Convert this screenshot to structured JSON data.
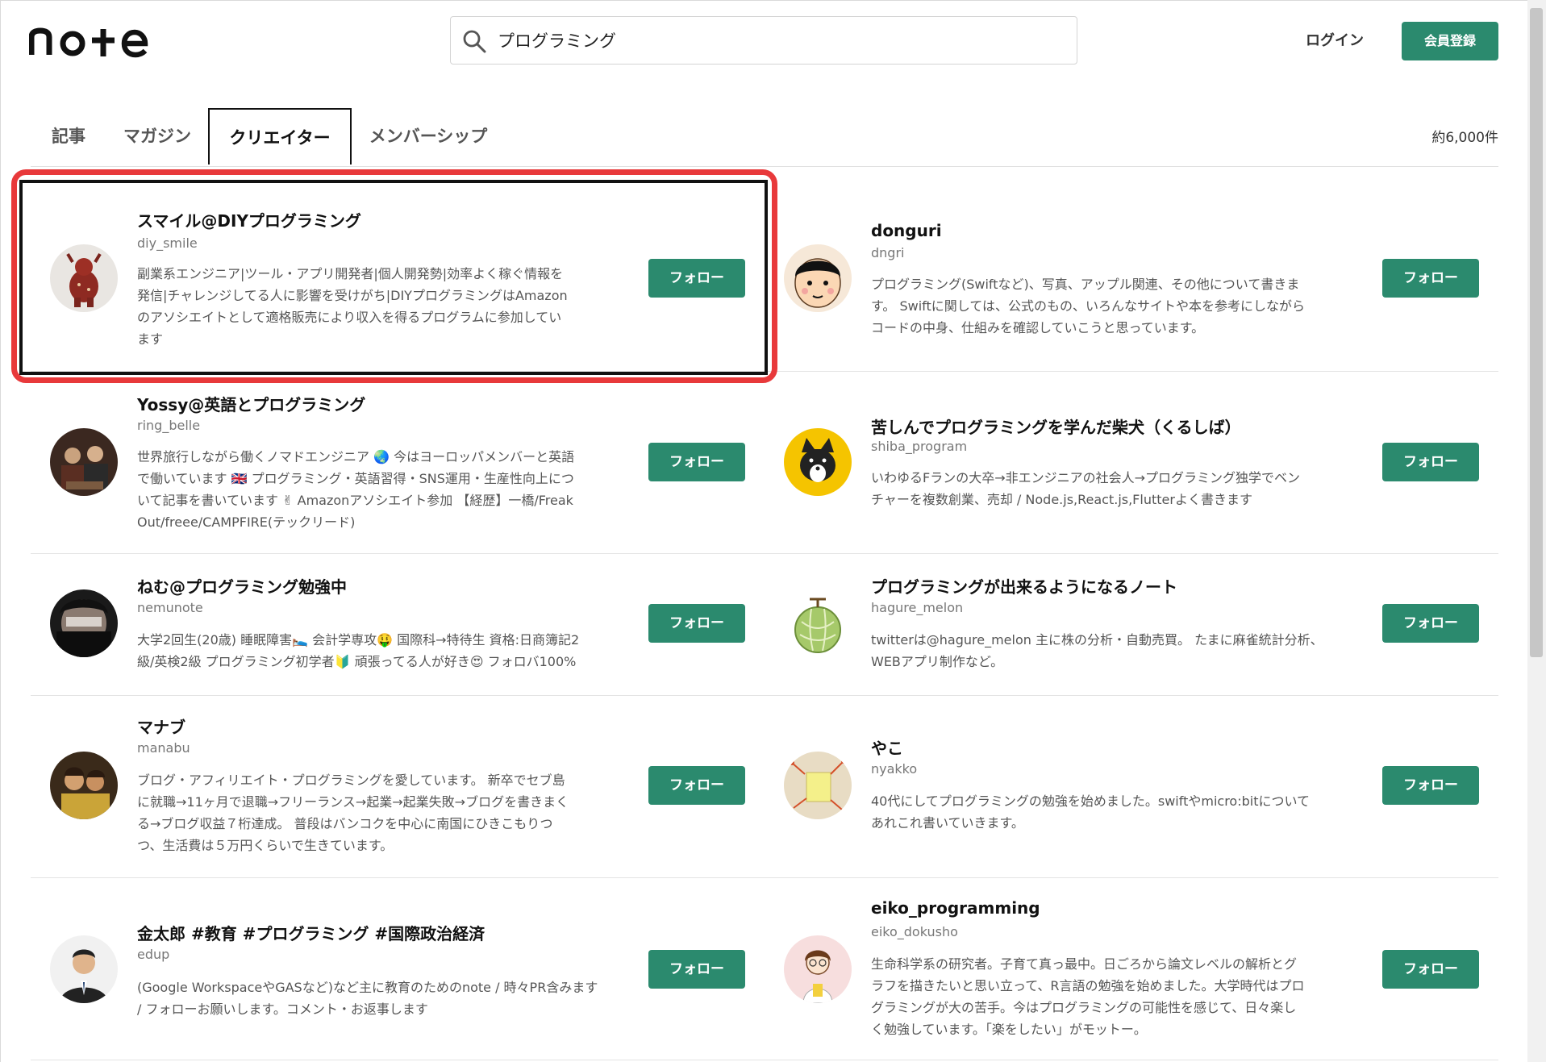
{
  "header": {
    "logo_text": "note",
    "search": {
      "value": "プログラミング",
      "placeholder": ""
    },
    "login_label": "ログイン",
    "signup_label": "会員登録"
  },
  "tabs": [
    {
      "label": "記事",
      "active": false
    },
    {
      "label": "マガジン",
      "active": false
    },
    {
      "label": "クリエイター",
      "active": true
    },
    {
      "label": "メンバーシップ",
      "active": false
    }
  ],
  "result_count": "約6,000件",
  "follow_label": "フォロー",
  "creators": [
    {
      "name": "スマイル@DIYプログラミング",
      "id": "diy_smile",
      "bio": [
        "副業系エンジニア|ツール・アプリ開発者|個人開発勢|効率よく稼ぐ情報を",
        "発信|チャレンジしてる人に影響を受けがち|DIYプログラミングはAmazon",
        "のアソシエイトとして適格販売により収入を得るプログラムに参加してい",
        "ます"
      ],
      "avatar_icon": "craft-figure-icon",
      "highlighted": true
    },
    {
      "name": "donguri",
      "id": "dngri",
      "bio": [
        "プログラミング(Swiftなど)、写真、アップル関連、その他について書きま",
        "す。 Swiftに関しては、公式のもの、いろんなサイトや本を参考にしながら",
        "コードの中身、仕組みを確認していこうと思っています。"
      ],
      "avatar_icon": "cartoon-face-icon"
    },
    {
      "name": "Yossy@英語とプログラミング",
      "id": "ring_belle",
      "bio": [
        "世界旅行しながら働くノマドエンジニア 🌏 今はヨーロッパメンバーと英語",
        "で働いています 🇬🇧 プログラミング・英語習得・SNS運用・生産性向上につ",
        "いて記事を書いています ✌ Amazonアソシエイト参加 【経歴】一橋/Freak",
        "Out/freee/CAMPFIRE(テックリード)"
      ],
      "avatar_icon": "group-photo-icon"
    },
    {
      "name": "苦しんでプログラミングを学んだ柴犬（くるしば）",
      "id": "shiba_program",
      "bio": [
        "いわゆるFランの大卒→非エンジニアの社会人→プログラミング独学でベン",
        "チャーを複数創業、売却 / Node.js,React.js,Flutterよく書きます"
      ],
      "avatar_icon": "shiba-dog-icon"
    },
    {
      "name": "ねむ@プログラミング勉強中",
      "id": "nemunote",
      "bio": [
        "大学2回生(20歳) 睡眠障害🛌 会計学専攻🤑 国際科→特待生 資格:日商簿記2",
        "級/英検2級 プログラミング初学者🔰 頑張ってる人が好き😍 フォロバ100%"
      ],
      "avatar_icon": "masked-face-icon"
    },
    {
      "name": "プログラミングが出来るようになるノート",
      "id": "hagure_melon",
      "bio": [
        "twitterは@hagure_melon 主に株の分析・自動売買。 たまに麻雀統計分析、",
        "WEBアプリ制作など。"
      ],
      "avatar_icon": "melon-icon"
    },
    {
      "name": "マナブ",
      "id": "manabu",
      "bio": [
        "ブログ・アフィリエイト・プログラミングを愛しています。 新卒でセブ島",
        "に就職→11ヶ月で退職→フリーランス→起業→起業失敗→ブログを書きまく",
        "る→ブログ収益７桁達成。 普段はバンコクを中心に南国にひきこもりつ",
        "つ、生活費は５万円くらいで生きています。"
      ],
      "avatar_icon": "person-photo-icon"
    },
    {
      "name": "やこ",
      "id": "nyakko",
      "bio": [
        "40代にしてプログラミングの勉強を始めました。swiftやmicro:bitについて",
        "あれこれ書いていきます。"
      ],
      "avatar_icon": "sticky-note-icon"
    },
    {
      "name": "金太郎 #教育 #プログラミング #国際政治経済",
      "id": "edup",
      "bio": [
        "(Google WorkspaceやGASなど)など主に教育のためのnote / 時々PR含みます",
        "/ フォローお願いします。コメント・お返事します"
      ],
      "avatar_icon": "suit-portrait-icon"
    },
    {
      "name": "eiko_programming",
      "id": "eiko_dokusho",
      "bio": [
        "生命科学系の研究者。子育て真っ最中。日ごろから論文レベルの解析とグ",
        "ラフを描きたいと思い立って、R言語の勉強を始めました。大学時代はプロ",
        "グラミングが大の苦手。今はプログラミングの可能性を感じて、日々楽し",
        "く勉強しています。「楽をしたい」がモットー。"
      ],
      "avatar_icon": "illustrated-woman-icon"
    }
  ],
  "colors": {
    "accent": "#2b8a6e",
    "highlight": "#e8393b"
  }
}
